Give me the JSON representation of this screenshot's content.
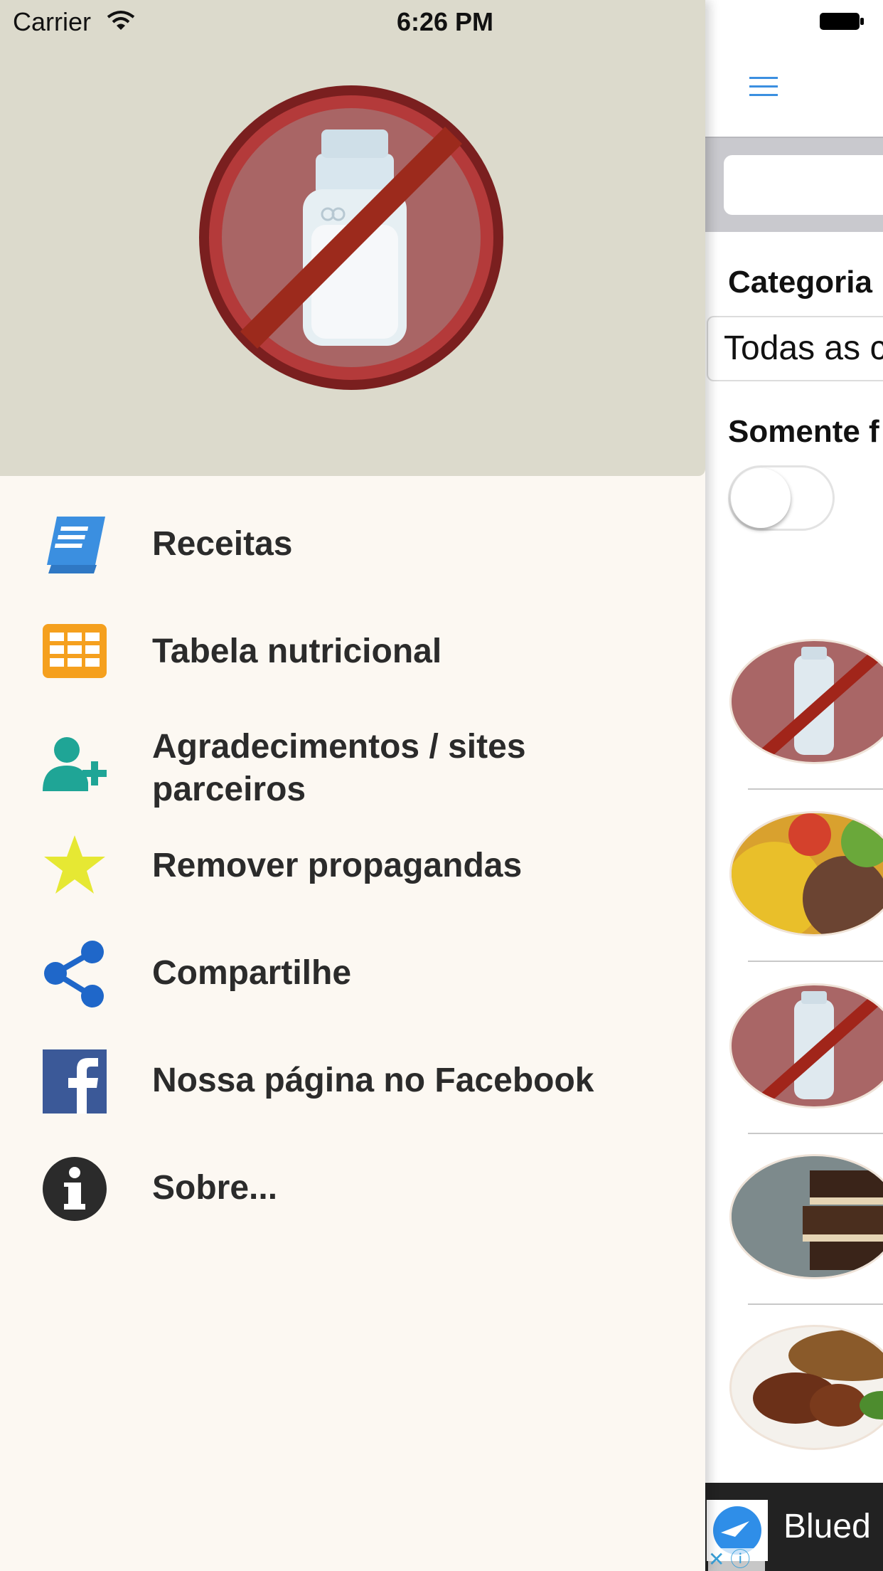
{
  "status_bar": {
    "carrier": "Carrier",
    "time": "6:26 PM"
  },
  "drawer": {
    "menu": [
      {
        "label": "Receitas",
        "icon": "book-icon",
        "color": "#3b8fe0"
      },
      {
        "label": "Tabela nutricional",
        "icon": "table-grid-icon",
        "color": "#f5a01e"
      },
      {
        "label": "Agradecimentos / sites parceiros",
        "icon": "add-user-icon",
        "color": "#1fa596"
      },
      {
        "label": "Remover propagandas",
        "icon": "star-icon",
        "color": "#e6e833"
      },
      {
        "label": "Compartilhe",
        "icon": "share-icon",
        "color": "#1f67c9"
      },
      {
        "label": "Nossa página no Facebook",
        "icon": "facebook-icon",
        "color": "#3b5998"
      },
      {
        "label": "Sobre...",
        "icon": "info-icon",
        "color": "#2b2b2b"
      }
    ]
  },
  "content": {
    "category_label": "Categoria",
    "category_value": "Todas as c",
    "only_label": "Somente f",
    "ad_text": "Blued",
    "accent_color": "#3b8fe0"
  }
}
